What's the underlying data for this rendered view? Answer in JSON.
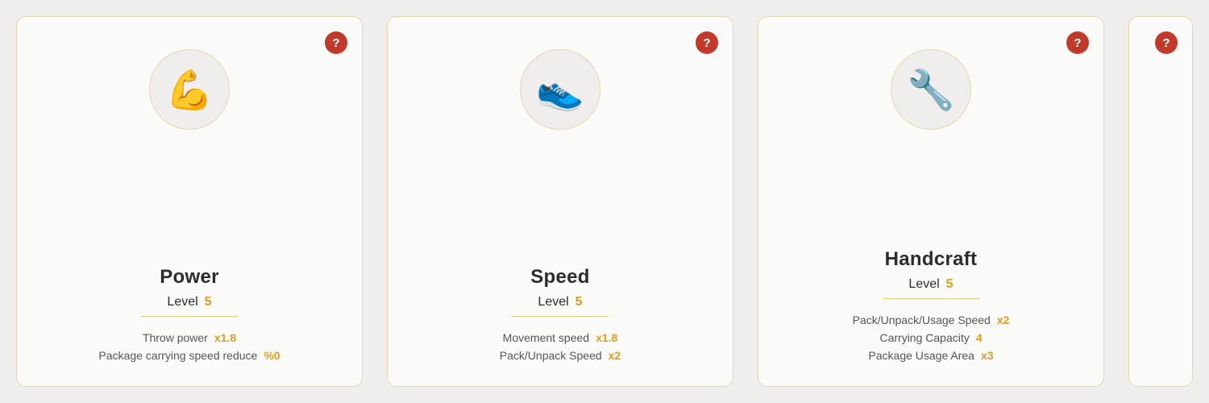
{
  "cards": [
    {
      "id": "power",
      "icon": "💪",
      "title": "Power",
      "level_label": "Level",
      "level_value": "5",
      "stats": [
        {
          "label": "Throw power",
          "value": "x1.8"
        },
        {
          "label": "Package carrying speed reduce",
          "value": "%0"
        }
      ]
    },
    {
      "id": "speed",
      "icon": "👟",
      "title": "Speed",
      "level_label": "Level",
      "level_value": "5",
      "stats": [
        {
          "label": "Movement speed",
          "value": "x1.8"
        },
        {
          "label": "Pack/Unpack Speed",
          "value": "x2"
        }
      ]
    },
    {
      "id": "handcraft",
      "icon": "🔧",
      "title": "Handcraft",
      "level_label": "Level",
      "level_value": "5",
      "stats": [
        {
          "label": "Pack/Unpack/Usage Speed",
          "value": "x2"
        },
        {
          "label": "Carrying Capacity",
          "value": "4"
        },
        {
          "label": "Package Usage Area",
          "value": "x3"
        }
      ]
    }
  ],
  "question_mark": "?",
  "partial_card": {
    "question_mark": "?"
  }
}
